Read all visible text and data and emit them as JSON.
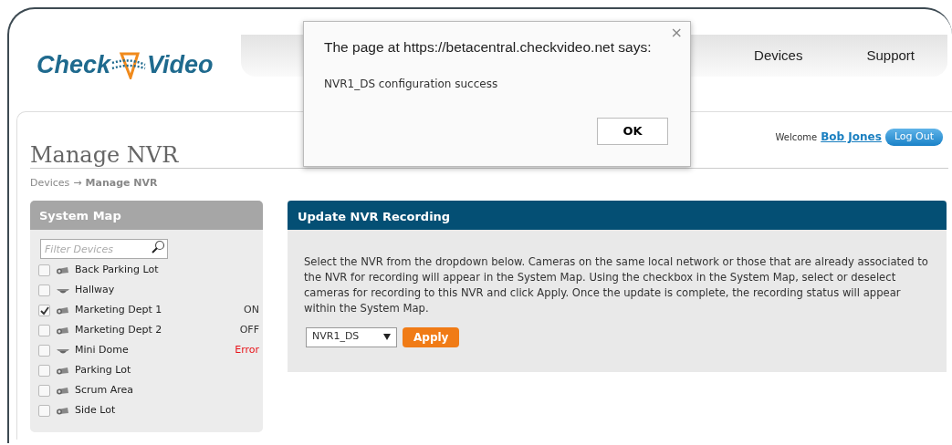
{
  "logo": {
    "left": "Check",
    "right": "Video"
  },
  "nav": [
    {
      "label": "Devices"
    },
    {
      "label": "Support"
    }
  ],
  "user": {
    "welcome": "Welcome",
    "name": "Bob Jones",
    "logout": "Log Out"
  },
  "page_title": "Manage NVR",
  "breadcrumb": {
    "parent": "Devices",
    "separator": "→",
    "current": "Manage NVR"
  },
  "system_map": {
    "title": "System Map",
    "filter": {
      "placeholder": "Filter Devices"
    },
    "devices": [
      {
        "name": "Back Parking Lot",
        "kind": "bullet",
        "checked": false
      },
      {
        "name": "Hallway",
        "kind": "dome",
        "checked": false
      },
      {
        "name": "Marketing Dept 1",
        "kind": "bullet",
        "checked": true,
        "status": "ON",
        "color": "#333333"
      },
      {
        "name": "Marketing Dept 2",
        "kind": "bullet",
        "checked": false,
        "status": "OFF",
        "color": "#333333"
      },
      {
        "name": "Mini Dome",
        "kind": "dome",
        "checked": false,
        "status": "Error",
        "color": "#e8141a"
      },
      {
        "name": "Parking Lot",
        "kind": "bullet",
        "checked": false
      },
      {
        "name": "Scrum Area",
        "kind": "bullet",
        "checked": false
      },
      {
        "name": "Side Lot",
        "kind": "bullet",
        "checked": false
      }
    ]
  },
  "update_panel": {
    "title": "Update NVR Recording",
    "text": "Select the NVR from the dropdown below. Cameras on the same local network or those that are already associated to the NVR for recording will appear in the System Map. Using the checkbox in the System Map, select or deselect cameras for recording to this NVR and click Apply. Once the update is complete, the recording status will appear within the System Map.",
    "nvr_select": "NVR1_DS",
    "apply": "Apply"
  },
  "dialog": {
    "title": "The page at https://betacentral.checkvideo.net says:",
    "close": "×",
    "message": "NVR1_DS configuration success",
    "ok": "OK"
  }
}
